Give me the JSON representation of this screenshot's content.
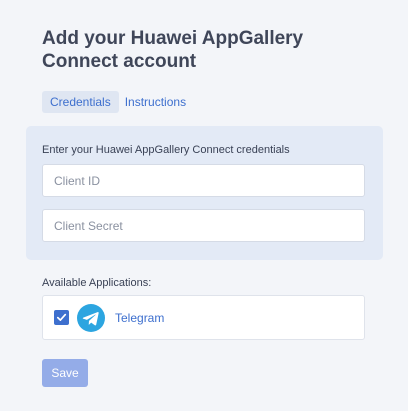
{
  "header": {
    "title": "Add your Huawei AppGallery Connect account"
  },
  "tabs": [
    {
      "label": "Credentials",
      "active": true
    },
    {
      "label": "Instructions",
      "active": false
    }
  ],
  "credentials": {
    "prompt": "Enter your Huawei AppGallery Connect credentials",
    "client_id": {
      "value": "",
      "placeholder": "Client ID"
    },
    "client_secret": {
      "value": "",
      "placeholder": "Client Secret"
    }
  },
  "applications": {
    "label": "Available Applications:",
    "items": [
      {
        "name": "Telegram",
        "checked": true,
        "icon": "telegram-icon"
      }
    ]
  },
  "actions": {
    "save_label": "Save"
  },
  "colors": {
    "accent": "#3d6fce",
    "panel": "#e3eaf6",
    "save_button": "#94ace8",
    "telegram": "#2ca5e0"
  }
}
